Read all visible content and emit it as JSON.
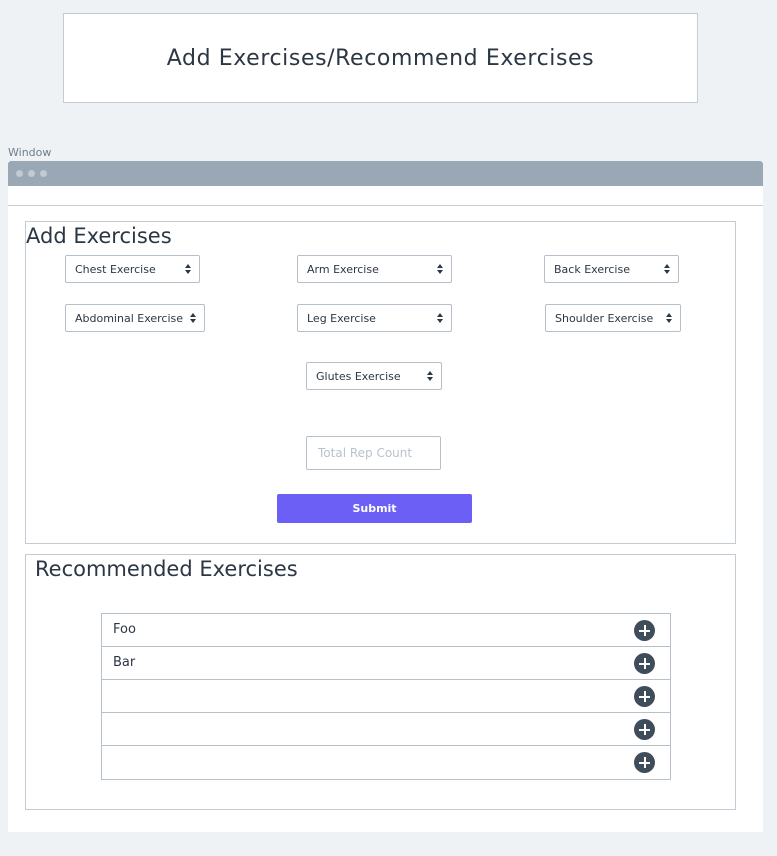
{
  "header": {
    "title": "Add Exercises/Recommend Exercises"
  },
  "window": {
    "label": "Window"
  },
  "add_panel": {
    "title": "Add Exercises",
    "selects": {
      "chest": "Chest Exercise",
      "arm": "Arm Exercise",
      "back": "Back Exercise",
      "abdominal": "Abdominal Exercise",
      "leg": "Leg Exercise",
      "shoulder": "Shoulder Exercise",
      "glutes": "Glutes Exercise"
    },
    "rep_count_placeholder": "Total Rep Count",
    "submit_label": "Submit"
  },
  "recommended_panel": {
    "title": "Recommended Exercises",
    "items": [
      {
        "label": "Foo"
      },
      {
        "label": "Bar"
      },
      {
        "label": ""
      },
      {
        "label": ""
      },
      {
        "label": ""
      }
    ],
    "add_icon": "plus-circle-icon"
  },
  "colors": {
    "accent": "#6b5ff5",
    "titlebar": "#9aa7b4",
    "add_icon": "#3f4c5a",
    "background": "#eff2f5"
  }
}
